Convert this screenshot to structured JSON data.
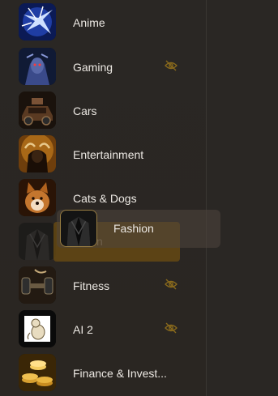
{
  "categories": [
    {
      "label": "Anime",
      "hidden": false
    },
    {
      "label": "Gaming",
      "hidden": true
    },
    {
      "label": "Cars",
      "hidden": false
    },
    {
      "label": "Entertainment",
      "hidden": false
    },
    {
      "label": "Cats & Dogs",
      "hidden": false
    },
    {
      "label": "Fashion",
      "hidden": false,
      "dragging": true
    },
    {
      "label": "Fitness",
      "hidden": true
    },
    {
      "label": "AI 2",
      "hidden": true
    },
    {
      "label": "Finance & Invest...",
      "hidden": false
    }
  ],
  "drag": {
    "label": "Fashion",
    "placeholder_label": "Fashion"
  },
  "colors": {
    "drop_slot": "#6e4e12",
    "panel": "#2a2724",
    "hidden_icon": "#8a6a1c"
  }
}
